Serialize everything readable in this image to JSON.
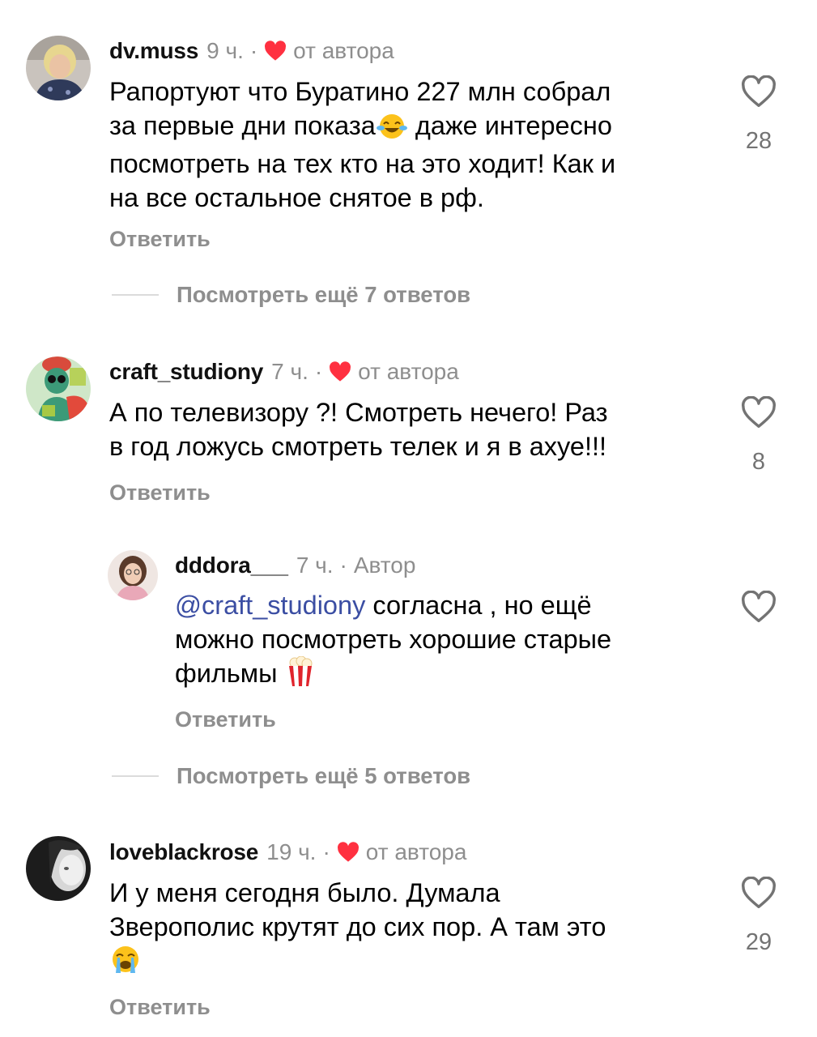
{
  "comments": [
    {
      "username": "dv.muss",
      "time": "9 ч.",
      "dot": "·",
      "author_tag": "от автора",
      "text_lines": [
        "Рапортуют что Буратино 227 млн собрал",
        "за первые дни показа",
        " даже интересно",
        "посмотреть на тех кто на это ходит! Как и",
        "на все остальное снятое в рф."
      ],
      "likes": "28",
      "reply_label": "Ответить",
      "more_replies": "Посмотреть ещё 7 ответов"
    },
    {
      "username": "craft_studiony",
      "time": "7 ч.",
      "dot": "·",
      "author_tag": "от автора",
      "text_lines": [
        "А по телевизору ?! Смотреть нечего! Раз",
        "в год ложусь смотреть телек и я в ахуе!!!"
      ],
      "likes": "8",
      "reply_label": "Ответить"
    },
    {
      "username": "dddora___",
      "time": "7 ч.",
      "dot": "·",
      "author_tag": "Автор",
      "mention": "@craft_studiony",
      "text_lines": [
        " согласна , но ещё",
        "можно посмотреть хорошие старые",
        "фильмы "
      ],
      "reply_label": "Ответить",
      "more_replies": "Посмотреть ещё 5 ответов"
    },
    {
      "username": "loveblackrose",
      "time": "19 ч.",
      "dot": "·",
      "author_tag": "от автора",
      "text_lines": [
        "И у меня сегодня было. Думала",
        "Зверополис крутят до сих пор. А там это"
      ],
      "likes": "29",
      "reply_label": "Ответить"
    }
  ],
  "colors": {
    "heart_red": "#ff3040",
    "muted": "#8e8e8e",
    "mention": "#3b4ea3"
  },
  "icons": {
    "like": "heart-outline-icon",
    "author_like": "heart-filled-icon",
    "laugh_emoji": "tears-of-joy-emoji",
    "popcorn_emoji": "popcorn-emoji",
    "cry_emoji": "loudly-crying-emoji"
  }
}
